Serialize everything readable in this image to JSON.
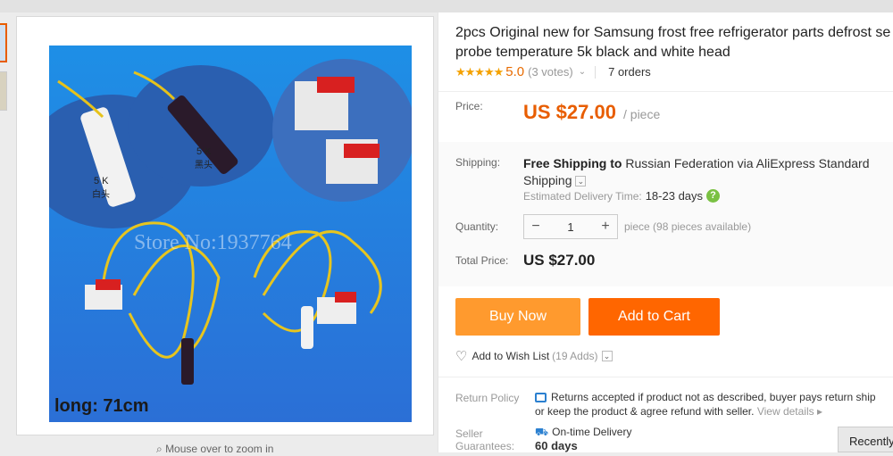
{
  "gallery": {
    "zoom_hint": "Mouse over to zoom in",
    "watermark": "Store No:1937764",
    "label_white": "5 K\n白头",
    "label_black": "5 K\n黑头",
    "length_label": "long: 71cm"
  },
  "product": {
    "title_line1": "2pcs Original new for Samsung frost free refrigerator parts defrost se",
    "title_line2": "probe temperature 5k black and white head",
    "stars": "★★★★★",
    "score": "5.0",
    "votes": "(3 votes)",
    "orders": "7 orders"
  },
  "price": {
    "label": "Price:",
    "value": "US $27.00",
    "unit": "/ piece"
  },
  "shipping": {
    "label": "Shipping:",
    "free": "Free Shipping",
    "to": " to ",
    "country": "Russian Federation",
    "via": " via ",
    "method": "AliExpress Standard",
    "method2": "Shipping",
    "est_label": "Estimated Delivery Time:",
    "est_days": "18-23 days"
  },
  "quantity": {
    "label": "Quantity:",
    "value": "1",
    "available": "piece (98 pieces available)"
  },
  "total": {
    "label": "Total Price:",
    "value": "US $27.00"
  },
  "actions": {
    "buy_now": "Buy Now",
    "add_to_cart": "Add to Cart",
    "wish_list": "Add to Wish List",
    "wish_adds": "(19 Adds)"
  },
  "policy": {
    "return_label": "Return Policy",
    "return_line1": "Returns accepted if product not as described, buyer pays return ship",
    "return_line2": "or keep the product & agree refund with seller.",
    "view_details": "View details ▸",
    "seller_label1": "Seller",
    "seller_label2": "Guarantees:",
    "ontime": "On-time Delivery",
    "ontime_days": "60 days"
  },
  "recently": "Recently"
}
